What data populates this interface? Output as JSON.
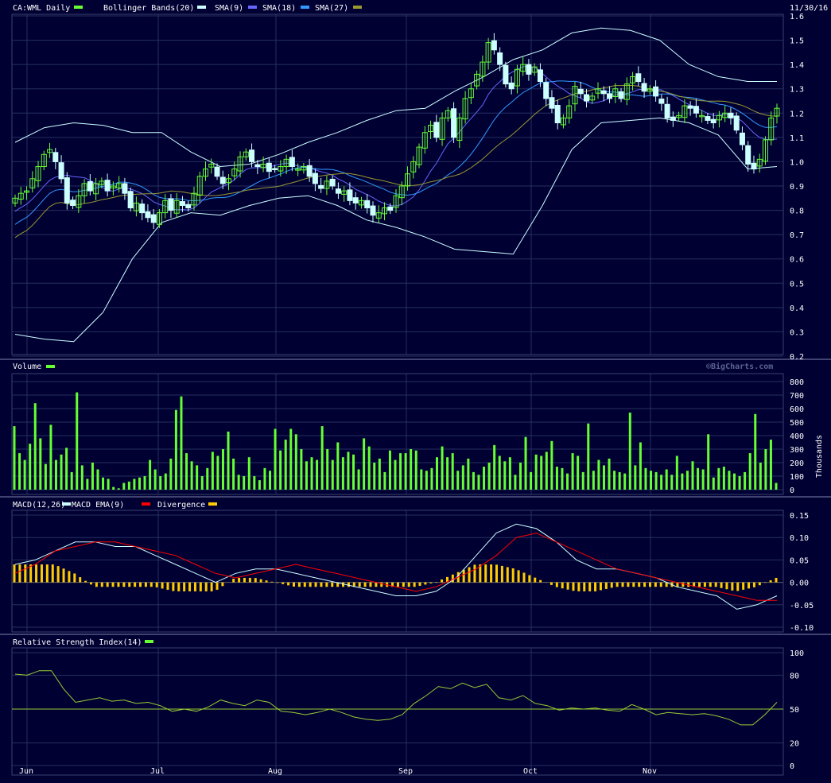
{
  "header": {
    "symbol": "CA:WML Daily",
    "date": "11/30/16",
    "legend": [
      {
        "label": "Bollinger Bands(20)",
        "color": "#ccffff"
      },
      {
        "label": "SMA(9)",
        "color": "#6666ff"
      },
      {
        "label": "SMA(18)",
        "color": "#3399ff"
      },
      {
        "label": "SMA(27)",
        "color": "#999933"
      }
    ],
    "symbol_swatch": "#66ff33",
    "watermark": "©BigCharts.com"
  },
  "volume_panel": {
    "title": "Volume",
    "swatch": "#66ff33",
    "unit": "Thousands"
  },
  "macd_panel": {
    "title": "MACD(12,26)",
    "ema_label": "MACD EMA(9)",
    "div_label": "Divergence",
    "macd_color": "#ccffff",
    "ema_color": "#ff0000",
    "div_color": "#ffcc00"
  },
  "rsi_panel": {
    "title": "Relative Strength Index(14)",
    "swatch": "#66ff33",
    "line_color": "#99cc33"
  },
  "colors": {
    "background": "#000033",
    "up": "#66ff33",
    "down": "#ccffff"
  },
  "chart_data": [
    {
      "type": "candlestick",
      "title": "CA:WML Daily",
      "x_ticks": [
        "Jun",
        "Jul",
        "Aug",
        "Sep",
        "Oct",
        "Nov"
      ],
      "y_ticks": [
        "0.2",
        "0.3",
        "0.4",
        "0.5",
        "0.6",
        "0.7",
        "0.8",
        "0.9",
        "1.0",
        "1.1",
        "1.2",
        "1.3",
        "1.4",
        "1.5",
        "1.6"
      ],
      "ylim": [
        0.2,
        1.6
      ],
      "close": [
        0.85,
        0.87,
        0.88,
        0.93,
        0.98,
        1.03,
        1.05,
        1.0,
        0.93,
        0.83,
        0.82,
        0.86,
        0.91,
        0.88,
        0.91,
        0.92,
        0.88,
        0.9,
        0.91,
        0.87,
        0.81,
        0.83,
        0.79,
        0.77,
        0.75,
        0.79,
        0.84,
        0.8,
        0.84,
        0.82,
        0.81,
        0.87,
        0.94,
        0.97,
        0.99,
        0.94,
        0.91,
        0.93,
        0.97,
        1.02,
        1.04,
        1.0,
        0.98,
        0.99,
        0.96,
        0.97,
        0.98,
        1.01,
        0.98,
        0.97,
        0.98,
        0.94,
        0.91,
        0.89,
        0.92,
        0.9,
        0.87,
        0.88,
        0.84,
        0.83,
        0.84,
        0.81,
        0.78,
        0.79,
        0.81,
        0.8,
        0.86,
        0.9,
        0.95,
        1.0,
        1.06,
        1.12,
        1.15,
        1.1,
        1.18,
        1.21,
        1.1,
        1.18,
        1.26,
        1.3,
        1.36,
        1.41,
        1.49,
        1.46,
        1.4,
        1.32,
        1.3,
        1.38,
        1.4,
        1.36,
        1.39,
        1.33,
        1.26,
        1.22,
        1.16,
        1.18,
        1.23,
        1.31,
        1.28,
        1.25,
        1.27,
        1.3,
        1.28,
        1.26,
        1.3,
        1.26,
        1.32,
        1.35,
        1.33,
        1.29,
        1.3,
        1.27,
        1.24,
        1.18,
        1.17,
        1.19,
        1.23,
        1.22,
        1.2,
        1.19,
        1.17,
        1.16,
        1.19,
        1.2,
        1.18,
        1.13,
        1.07,
        0.99,
        0.97,
        1.01,
        1.09,
        1.18,
        1.22
      ],
      "bollinger_upper": [
        1.08,
        1.14,
        1.16,
        1.15,
        1.12,
        1.12,
        1.04,
        0.98,
        0.99,
        1.03,
        1.08,
        1.12,
        1.17,
        1.21,
        1.22,
        1.29,
        1.35,
        1.42,
        1.46,
        1.53,
        1.55,
        1.54,
        1.5,
        1.4,
        1.35,
        1.33,
        1.33
      ],
      "bollinger_lower": [
        0.29,
        0.27,
        0.26,
        0.38,
        0.6,
        0.75,
        0.79,
        0.78,
        0.82,
        0.85,
        0.86,
        0.82,
        0.76,
        0.73,
        0.69,
        0.64,
        0.63,
        0.62,
        0.82,
        1.05,
        1.16,
        1.17,
        1.18,
        1.16,
        1.11,
        0.97,
        0.98
      ]
    },
    {
      "type": "bar",
      "title": "Volume",
      "ylabel": "Thousands",
      "y_ticks": [
        "0",
        "100",
        "200",
        "300",
        "400",
        "500",
        "600",
        "700",
        "800"
      ],
      "ylim": [
        0,
        800
      ],
      "values": [
        470,
        270,
        220,
        340,
        640,
        380,
        190,
        480,
        220,
        260,
        310,
        130,
        720,
        180,
        80,
        200,
        150,
        90,
        80,
        20,
        10,
        50,
        60,
        80,
        90,
        100,
        220,
        150,
        100,
        120,
        230,
        590,
        690,
        270,
        210,
        180,
        100,
        160,
        280,
        250,
        300,
        430,
        230,
        110,
        100,
        240,
        100,
        70,
        160,
        140,
        450,
        290,
        370,
        450,
        410,
        300,
        210,
        240,
        220,
        470,
        300,
        220,
        350,
        240,
        280,
        260,
        150,
        380,
        320,
        200,
        230,
        130,
        290,
        220,
        270,
        270,
        300,
        290,
        150,
        140,
        160,
        240,
        320,
        240,
        270,
        140,
        180,
        230,
        130,
        110,
        170,
        200,
        330,
        250,
        210,
        240,
        110,
        200,
        390,
        130,
        260,
        250,
        280,
        360,
        170,
        160,
        120,
        270,
        250,
        130,
        490,
        140,
        220,
        180,
        230,
        140,
        130,
        120,
        570,
        180,
        350,
        160,
        140,
        130,
        110,
        150,
        110,
        250,
        120,
        140,
        210,
        160,
        150,
        410,
        90,
        160,
        170,
        140,
        120,
        100,
        130,
        270,
        560,
        200,
        300,
        370,
        50
      ],
      "note": "daily volume in thousands"
    },
    {
      "type": "line",
      "title": "MACD(12,26)",
      "y_ticks": [
        "0.15",
        "0.10",
        "0.05",
        "0.00",
        "-0.05",
        "-0.10"
      ],
      "ylim": [
        -0.1,
        0.15
      ],
      "series": [
        {
          "name": "MACD(12,26)",
          "values": [
            0.04,
            0.05,
            0.07,
            0.09,
            0.09,
            0.08,
            0.08,
            0.06,
            0.04,
            0.02,
            0.0,
            0.02,
            0.03,
            0.03,
            0.02,
            0.01,
            0.0,
            -0.01,
            -0.02,
            -0.03,
            -0.03,
            -0.02,
            0.01,
            0.06,
            0.11,
            0.13,
            0.12,
            0.09,
            0.05,
            0.03,
            0.03,
            0.02,
            0.01,
            -0.01,
            -0.02,
            -0.03,
            -0.06,
            -0.05,
            -0.03
          ]
        },
        {
          "name": "MACD EMA(9)",
          "values": [
            0.02,
            0.04,
            0.07,
            0.08,
            0.09,
            0.09,
            0.08,
            0.07,
            0.06,
            0.04,
            0.02,
            0.01,
            0.02,
            0.03,
            0.04,
            0.03,
            0.02,
            0.01,
            0.0,
            -0.01,
            -0.02,
            -0.01,
            0.01,
            0.03,
            0.06,
            0.1,
            0.11,
            0.09,
            0.07,
            0.05,
            0.03,
            0.02,
            0.01,
            0.0,
            -0.01,
            -0.02,
            -0.03,
            -0.04,
            -0.04
          ]
        },
        {
          "name": "Divergence",
          "values": [
            0.04,
            0.04,
            0.04,
            0.02,
            -0.01,
            -0.01,
            -0.01,
            -0.01,
            -0.02,
            -0.02,
            -0.02,
            0.01,
            0.01,
            0.0,
            -0.01,
            -0.01,
            -0.01,
            -0.01,
            -0.01,
            -0.01,
            -0.01,
            0.0,
            0.02,
            0.04,
            0.04,
            0.03,
            0.01,
            -0.01,
            -0.02,
            -0.02,
            -0.01,
            -0.01,
            -0.01,
            -0.01,
            -0.01,
            -0.01,
            -0.02,
            -0.01,
            0.01
          ]
        }
      ]
    },
    {
      "type": "line",
      "title": "Relative Strength Index(14)",
      "y_ticks": [
        "100",
        "80",
        "50",
        "20",
        "0"
      ],
      "ylim": [
        0,
        100
      ],
      "values": [
        81,
        80,
        84,
        84,
        68,
        56,
        58,
        60,
        57,
        58,
        55,
        56,
        53,
        48,
        50,
        48,
        52,
        58,
        55,
        53,
        58,
        56,
        48,
        47,
        45,
        47,
        50,
        47,
        43,
        41,
        40,
        41,
        45,
        55,
        62,
        70,
        68,
        73,
        69,
        72,
        60,
        58,
        62,
        55,
        53,
        49,
        51,
        50,
        51,
        49,
        48,
        54,
        50,
        45,
        47,
        46,
        45,
        46,
        44,
        41,
        36,
        36,
        45,
        56
      ]
    }
  ]
}
